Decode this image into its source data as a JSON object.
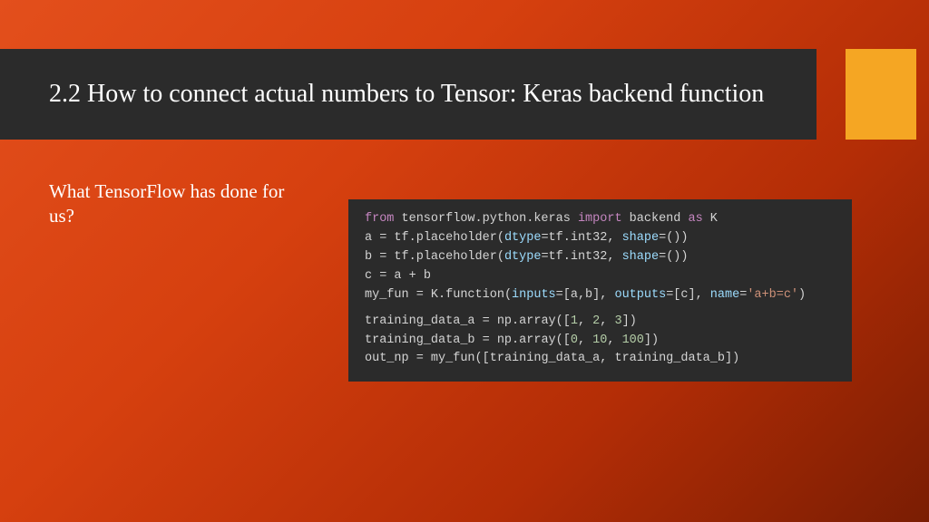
{
  "title": "2.2 How to connect actual numbers to Tensor: Keras backend function",
  "subtitle": "What TensorFlow has done for us?",
  "code": {
    "l1a": "from",
    "l1b": " tensorflow.python.keras ",
    "l1c": "import",
    "l1d": " backend ",
    "l1e": "as",
    "l1f": " K",
    "l2a": "a ",
    "l2b": "=",
    "l2c": " tf.placeholder(",
    "l2d": "dtype",
    "l2e": "=tf.int32, ",
    "l2f": "shape",
    "l2g": "=())",
    "l3a": "b ",
    "l3b": "=",
    "l3c": " tf.placeholder(",
    "l3d": "dtype",
    "l3e": "=tf.int32, ",
    "l3f": "shape",
    "l3g": "=())",
    "l4a": "c ",
    "l4b": "=",
    "l4c": " a ",
    "l4d": "+",
    "l4e": " b",
    "l5a": "my_fun ",
    "l5b": "=",
    "l5c": " K.function(",
    "l5d": "inputs",
    "l5e": "=[a,b], ",
    "l5f": "outputs",
    "l5g": "=[c], ",
    "l5h": "name",
    "l5i": "=",
    "l5j": "'a+b=c'",
    "l5k": ")",
    "l6a": "training_data_a ",
    "l6b": "=",
    "l6c": " np.array([",
    "l6d": "1",
    "l6e": ", ",
    "l6f": "2",
    "l6g": ", ",
    "l6h": "3",
    "l6i": "])",
    "l7a": "training_data_b ",
    "l7b": "=",
    "l7c": " np.array([",
    "l7d": "0",
    "l7e": ", ",
    "l7f": "10",
    "l7g": ", ",
    "l7h": "100",
    "l7i": "])",
    "l8a": "out_np ",
    "l8b": "=",
    "l8c": " my_fun([training_data_a, training_data_b])"
  }
}
